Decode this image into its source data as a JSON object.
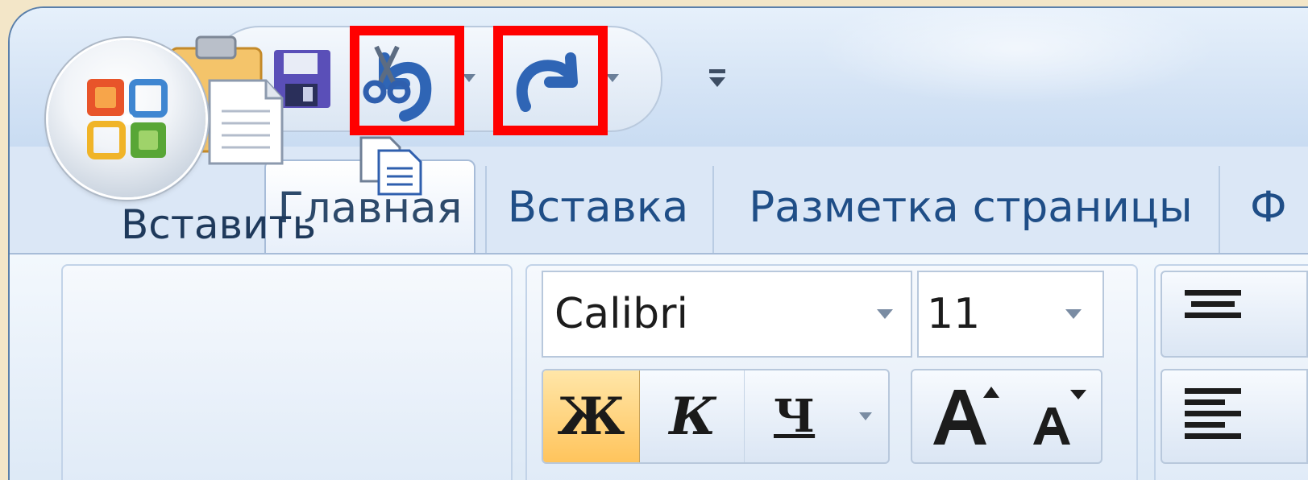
{
  "tabs": {
    "home": "Главная",
    "insert": "Вставка",
    "page_layout": "Разметка страницы",
    "next_partial": "Ф"
  },
  "clipboard": {
    "paste_label": "Вставить"
  },
  "font": {
    "name": "Calibri",
    "size": "11",
    "bold_label": "Ж",
    "italic_label": "К",
    "underline_label": "Ч"
  },
  "highlight_color": "#ff0000",
  "accent_color": "#1f4e87",
  "icons": [
    "office-logo-icon",
    "save-icon",
    "undo-icon",
    "redo-icon",
    "customize-qat-icon",
    "paste-icon",
    "cut-icon",
    "copy-icon",
    "grow-font-icon",
    "shrink-font-icon",
    "align-center-icon",
    "align-left-icon"
  ]
}
